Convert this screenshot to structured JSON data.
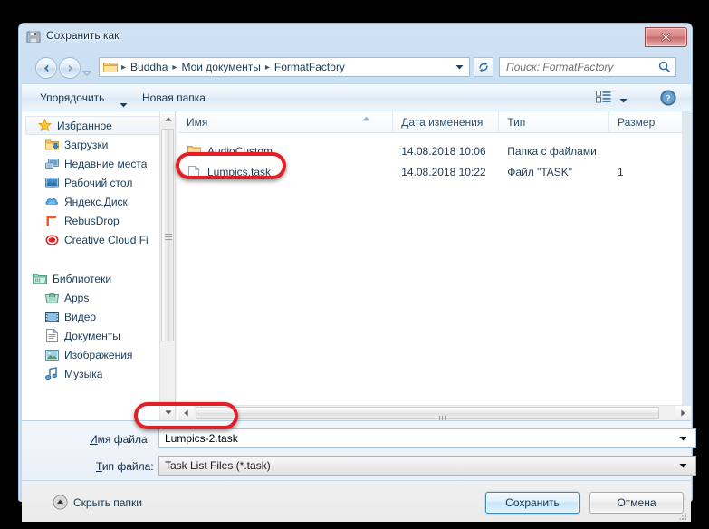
{
  "window": {
    "title": "Сохранить как",
    "icon": "save-window-icon",
    "close_label": "✕"
  },
  "navbar": {
    "back_icon": "back-arrow-icon",
    "forward_icon": "forward-arrow-icon",
    "history_icon": "history-dropdown-icon",
    "folder_icon": "folder-icon",
    "breadcrumbs": [
      "Buddha",
      "Мои документы",
      "FormatFactory"
    ],
    "separator": "▸",
    "dropdown_icon": "chevron-down-icon",
    "refresh_icon": "refresh-icon",
    "search": {
      "placeholder": "Поиск: FormatFactory",
      "icon": "search-icon"
    }
  },
  "toolbar": {
    "organize_label": "Упорядочить",
    "organize_caret": "caret-down-icon",
    "new_folder_label": "Новая папка",
    "view_icon": "view-mode-icon",
    "view_caret": "caret-down-icon",
    "help_icon": "help-icon"
  },
  "nav_pane": {
    "groups": [
      {
        "header": {
          "label": "Избранное",
          "icon": "star-icon",
          "selected": true
        },
        "items": [
          {
            "label": "Загрузки",
            "icon": "downloads-folder-icon"
          },
          {
            "label": "Недавние места",
            "icon": "recent-places-icon"
          },
          {
            "label": "Рабочий стол",
            "icon": "desktop-icon"
          },
          {
            "label": "Яндекс.Диск",
            "icon": "yandex-disk-icon"
          },
          {
            "label": "RebusDrop",
            "icon": "rebusdrop-icon"
          },
          {
            "label": "Creative Cloud Fi",
            "icon": "creative-cloud-icon"
          }
        ]
      },
      {
        "header": {
          "label": "Библиотеки",
          "icon": "libraries-icon",
          "selected": false
        },
        "items": [
          {
            "label": "Apps",
            "icon": "apps-library-icon"
          },
          {
            "label": "Видео",
            "icon": "video-library-icon"
          },
          {
            "label": "Документы",
            "icon": "documents-library-icon"
          },
          {
            "label": "Изображения",
            "icon": "pictures-library-icon"
          },
          {
            "label": "Музыка",
            "icon": "music-library-icon"
          }
        ]
      }
    ],
    "scrollbar": {
      "up_icon": "scroll-up-arrow-icon",
      "down_icon": "scroll-down-arrow-icon"
    }
  },
  "file_list": {
    "columns": [
      {
        "key": "name",
        "label": "Имя",
        "sorted": true,
        "sort_icon": "sort-ascending-icon"
      },
      {
        "key": "date",
        "label": "Дата изменения"
      },
      {
        "key": "type",
        "label": "Тип"
      },
      {
        "key": "size",
        "label": "Размер"
      }
    ],
    "rows": [
      {
        "name": "AudioCustom",
        "icon": "folder-icon",
        "date": "14.08.2018 10:06",
        "type": "Папка с файлами",
        "size": ""
      },
      {
        "name": "Lumpics.task",
        "icon": "generic-file-icon",
        "date": "14.08.2018 10:22",
        "type": "Файл \"TASK\"",
        "size": "1"
      }
    ],
    "hscrollbar": {
      "left_icon": "scroll-left-arrow-icon",
      "right_icon": "scroll-right-arrow-icon"
    }
  },
  "form": {
    "filename_label": "Имя файла",
    "filename_label_accel": "И",
    "filename_value": "Lumpics-2.task",
    "filetype_label": "Тип файла:",
    "filetype_label_accel": "Т",
    "filetype_value": "Task List Files (*.task)",
    "caret_icon": "caret-down-icon"
  },
  "footer": {
    "hide_folders_label": "Скрыть папки",
    "hide_folders_icon": "collapse-up-icon",
    "save_label": "Сохранить",
    "cancel_label": "Отмена",
    "resize_grip_icon": "resize-grip-icon"
  },
  "annotations": [
    {
      "name": "highlight-file-lumpics-task",
      "color": "#e31e24"
    },
    {
      "name": "highlight-filename-field",
      "color": "#e31e24"
    }
  ]
}
